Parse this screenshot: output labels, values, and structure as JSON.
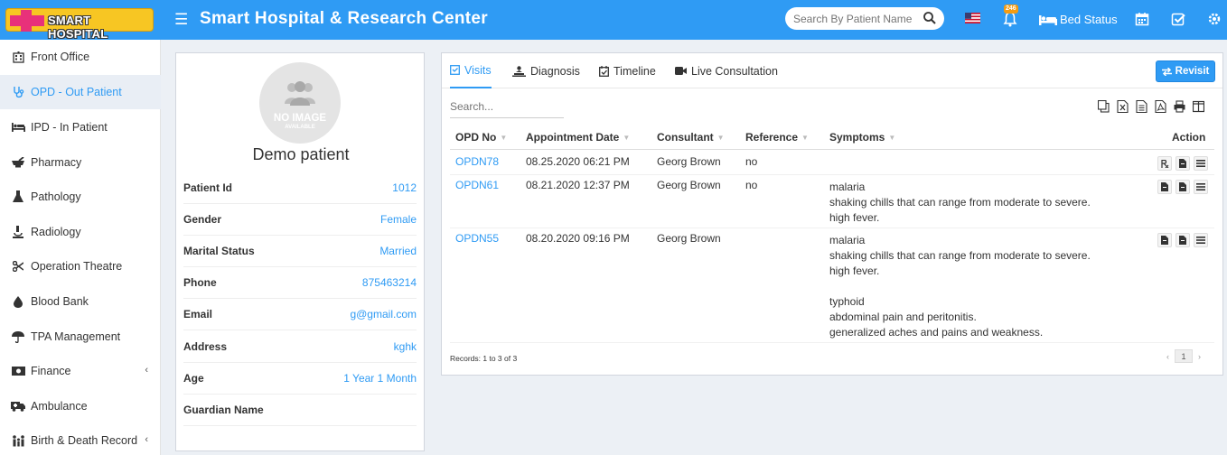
{
  "brand": {
    "logo_text": "SMART HOSPITAL",
    "app_title": "Smart Hospital & Research Center"
  },
  "header": {
    "search_placeholder": "Search By Patient Name",
    "notification_count": "246",
    "bed_status_label": "Bed Status"
  },
  "sidebar": {
    "items": [
      {
        "label": "Front Office",
        "icon": "building-icon"
      },
      {
        "label": "OPD - Out Patient",
        "icon": "stethoscope-icon"
      },
      {
        "label": "IPD - In Patient",
        "icon": "bed-icon"
      },
      {
        "label": "Pharmacy",
        "icon": "mortar-pestle-icon"
      },
      {
        "label": "Pathology",
        "icon": "flask-icon"
      },
      {
        "label": "Radiology",
        "icon": "microscope-icon"
      },
      {
        "label": "Operation Theatre",
        "icon": "scissors-icon"
      },
      {
        "label": "Blood Bank",
        "icon": "droplet-icon"
      },
      {
        "label": "TPA Management",
        "icon": "umbrella-icon"
      },
      {
        "label": "Finance",
        "icon": "money-icon"
      },
      {
        "label": "Ambulance",
        "icon": "ambulance-icon"
      },
      {
        "label": "Birth & Death Record",
        "icon": "family-icon"
      }
    ]
  },
  "patient": {
    "image_text": "NO IMAGE",
    "image_subtext": "AVAILABLE",
    "name": "Demo patient",
    "fields": [
      {
        "label": "Patient Id",
        "value": "1012"
      },
      {
        "label": "Gender",
        "value": "Female"
      },
      {
        "label": "Marital Status",
        "value": "Married"
      },
      {
        "label": "Phone",
        "value": "875463214"
      },
      {
        "label": "Email",
        "value": "g@gmail.com"
      },
      {
        "label": "Address",
        "value": "kghk"
      },
      {
        "label": "Age",
        "value": "1 Year 1 Month"
      },
      {
        "label": "Guardian Name",
        "value": ""
      }
    ]
  },
  "tabs": [
    {
      "label": "Visits",
      "active": true
    },
    {
      "label": "Diagnosis"
    },
    {
      "label": "Timeline"
    },
    {
      "label": "Live Consultation"
    }
  ],
  "revisit_label": "Revisit",
  "table": {
    "search_placeholder": "Search...",
    "columns": [
      "OPD No",
      "Appointment Date",
      "Consultant",
      "Reference",
      "Symptoms",
      "Action"
    ],
    "rows": [
      {
        "opd_no": "OPDN78",
        "date": "08.25.2020 06:21 PM",
        "consultant": "Georg Brown",
        "reference": "no",
        "symptoms": []
      },
      {
        "opd_no": "OPDN61",
        "date": "08.21.2020 12:37 PM",
        "consultant": "Georg Brown",
        "reference": "no",
        "symptoms": [
          "malaria",
          "shaking chills that can range from moderate to severe.",
          "high fever."
        ]
      },
      {
        "opd_no": "OPDN55",
        "date": "08.20.2020 09:16 PM",
        "consultant": "Georg Brown",
        "reference": "",
        "symptoms": [
          "malaria",
          "shaking chills that can range from moderate to severe.",
          "high fever.",
          "",
          "typhoid",
          "abdominal pain and peritonitis.",
          "generalized aches and pains and weakness."
        ]
      }
    ],
    "records_text": "Records: 1 to 3 of 3",
    "current_page": "1"
  },
  "colors": {
    "primary": "#2f9bf4",
    "logo_bg": "#f7c623",
    "logo_cross": "#e8317a"
  }
}
